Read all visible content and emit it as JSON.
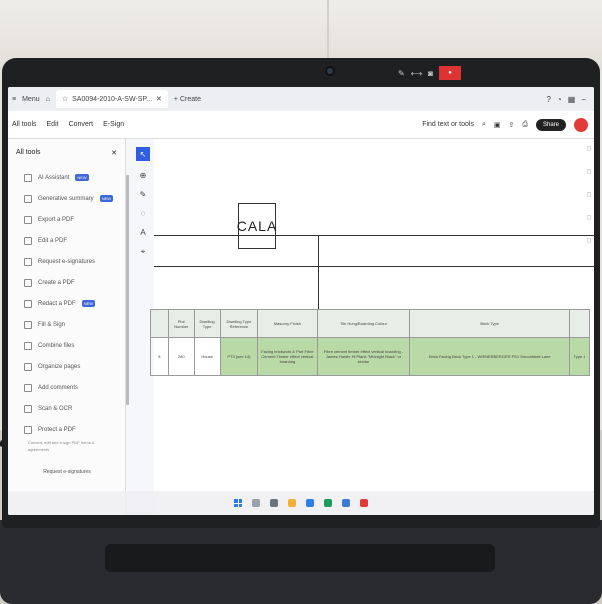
{
  "browser": {
    "menu_label": "Menu",
    "tab_title": "SA0094-2010-A-SW-SP...",
    "new_tab_label": "Create"
  },
  "menubar": {
    "items": [
      "All tools",
      "Edit",
      "Convert",
      "E-Sign"
    ],
    "find_label": "Find text or tools",
    "share_label": "Share"
  },
  "tools_panel": {
    "title": "All tools",
    "items": [
      {
        "label": "AI Assistant",
        "badge": "NEW"
      },
      {
        "label": "Generative summary",
        "badge": "NEW"
      },
      {
        "label": "Export a PDF",
        "badge": ""
      },
      {
        "label": "Edit a PDF",
        "badge": ""
      },
      {
        "label": "Request e-signatures",
        "badge": ""
      },
      {
        "label": "Create a PDF",
        "badge": ""
      },
      {
        "label": "Redact a PDF",
        "badge": "NEW"
      },
      {
        "label": "Fill & Sign",
        "badge": ""
      },
      {
        "label": "Combine files",
        "badge": ""
      },
      {
        "label": "Organize pages",
        "badge": ""
      },
      {
        "label": "Add comments",
        "badge": ""
      },
      {
        "label": "Scan & OCR",
        "badge": ""
      },
      {
        "label": "Protect a PDF",
        "badge": ""
      }
    ],
    "footer_note": "Convert, edit and e-sign PDF forms & agreements",
    "footer_link": "Request e-signatures"
  },
  "document": {
    "logo_text": "CALA",
    "table": {
      "headers": [
        "Plot Number",
        "Dwelling Type",
        "Dwelling Type Reference",
        "Masonry Finish",
        "Tile Hung/Boarding Colour",
        "Brick Type"
      ],
      "row": {
        "index": "8",
        "plot": "280",
        "type": "House",
        "reference": "PT3 (see 14)",
        "masonry": "Facing brickwork & Part Fibre Cement Timber effect vertical boarding",
        "tile": "Fibre cement timber effect vertical boarding - James Hardie Hi Plank \"Midnight Black\" or similar",
        "brick": "Brick Facing Brick Type 1 - WIENERBERGER PS1 Smoothbelt Lane",
        "extra": "Type 1"
      }
    }
  }
}
